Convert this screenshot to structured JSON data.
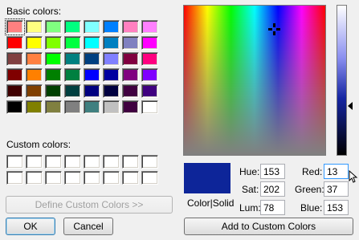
{
  "basic_colors_label": "Basic colors:",
  "custom_colors_label": "Custom colors:",
  "basic_colors": [
    "#ff8080",
    "#ffff80",
    "#80ff80",
    "#00ff80",
    "#80ffff",
    "#0080ff",
    "#ff80c0",
    "#ff80ff",
    "#ff0000",
    "#ffff00",
    "#80ff00",
    "#00ff40",
    "#00ffff",
    "#0080c0",
    "#8080c0",
    "#ff00ff",
    "#804040",
    "#ff8040",
    "#00ff00",
    "#008080",
    "#004080",
    "#8080ff",
    "#800040",
    "#ff0080",
    "#800000",
    "#ff8000",
    "#008000",
    "#008040",
    "#0000ff",
    "#0000a0",
    "#800080",
    "#8000ff",
    "#400000",
    "#804000",
    "#004000",
    "#004040",
    "#000080",
    "#000040",
    "#400040",
    "#400080",
    "#000000",
    "#808000",
    "#808040",
    "#808080",
    "#408080",
    "#c0c0c0",
    "#400040",
    "#ffffff"
  ],
  "custom_colors": [
    "",
    "",
    "",
    "",
    "",
    "",
    "",
    "",
    "",
    "",
    "",
    "",
    "",
    "",
    "",
    ""
  ],
  "buttons": {
    "define_custom": "Define Custom Colors >>",
    "ok": "OK",
    "cancel": "Cancel",
    "add_custom": "Add to Custom Colors"
  },
  "preview_label": "Color|Solid",
  "preview_color": "#0d2599",
  "fields": {
    "hue_label": "Hue:",
    "hue": "153",
    "sat_label": "Sat:",
    "sat": "202",
    "lum_label": "Lum:",
    "lum": "78",
    "red_label": "Red:",
    "red": "13",
    "green_label": "Green:",
    "green": "37",
    "blue_label": "Blue:",
    "blue": "153"
  }
}
